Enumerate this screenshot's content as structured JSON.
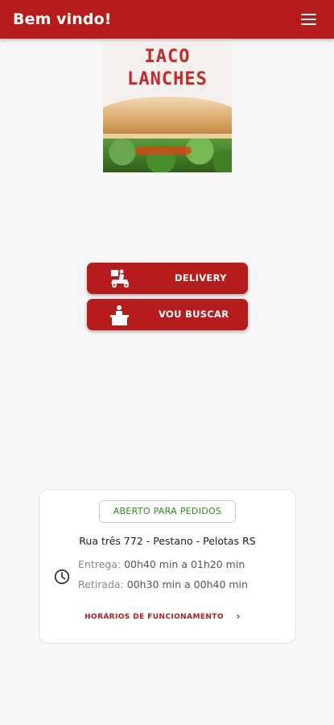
{
  "header": {
    "title": "Bem vindo!",
    "menu_icon": "menu-icon"
  },
  "logo": {
    "line1": "IACO",
    "line2": "LANCHES"
  },
  "actions": {
    "delivery_label": "DELIVERY",
    "delivery_icon": "delivery-scooter-icon",
    "pickup_label": "VOU BUSCAR",
    "pickup_icon": "pickup-counter-icon"
  },
  "info": {
    "status": "ABERTO PARA PEDIDOS",
    "address": "Rua três 772 - Pestano - Pelotas RS",
    "delivery_label": "Entrega:",
    "delivery_time": "00h40 min a 01h20 min",
    "pickup_label": "Retirada:",
    "pickup_time": "00h30 min a 00h40 min",
    "hours_link": "HORÁRIOS DE FUNCIONAMENTO",
    "clock_icon": "clock-icon",
    "chevron_icon": "chevron-right-icon"
  },
  "colors": {
    "primary": "#b71c1c",
    "status_green": "#2e8b1f",
    "background": "#f7f7f7"
  }
}
